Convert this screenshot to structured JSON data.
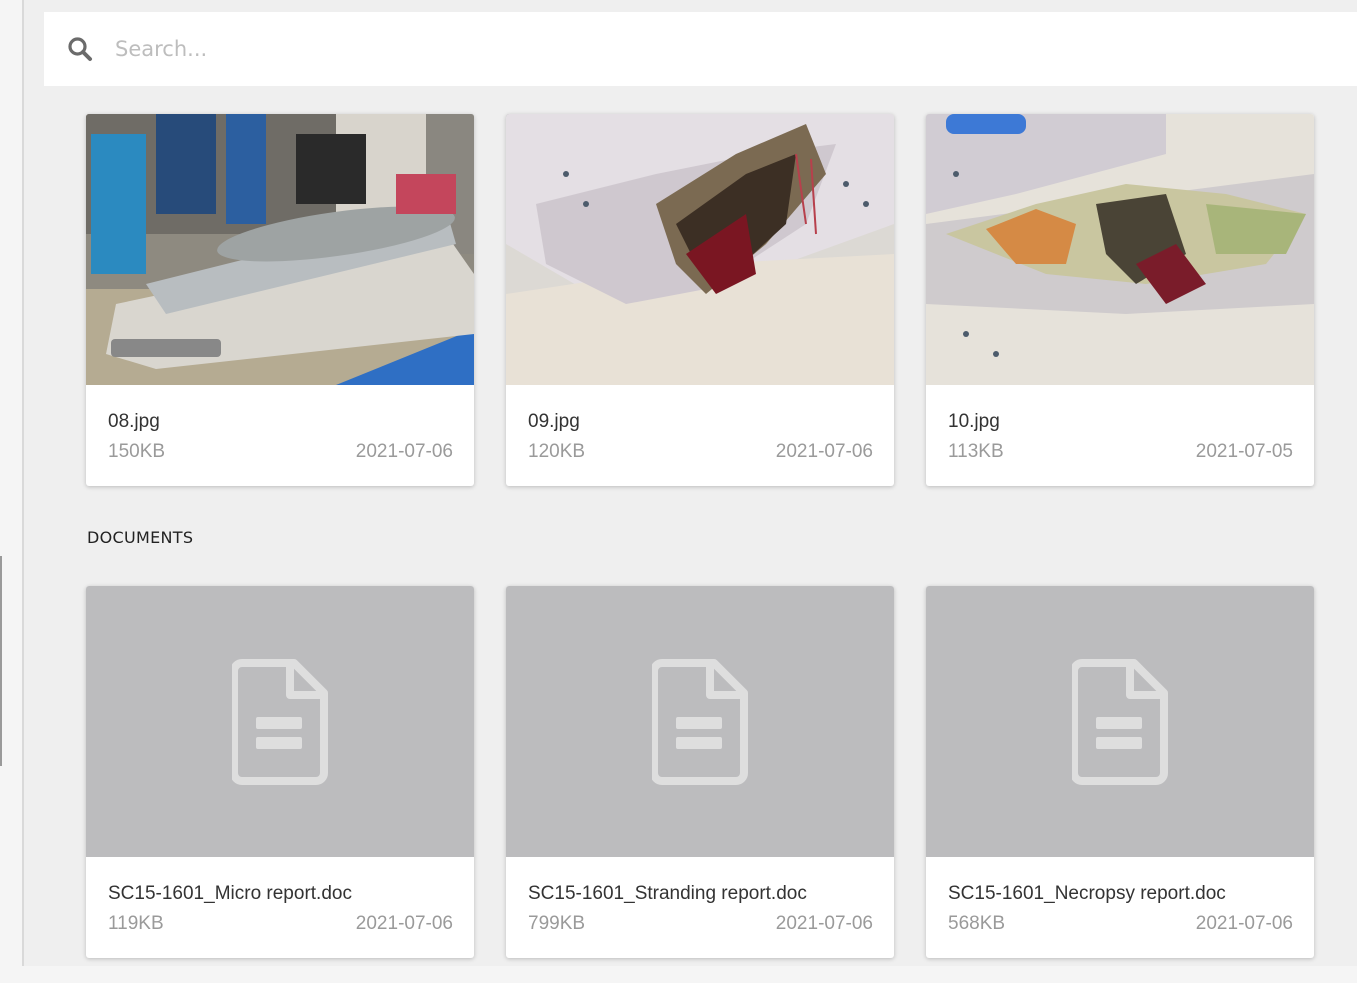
{
  "search": {
    "placeholder": "Search..."
  },
  "images": [
    {
      "name": "08.jpg",
      "size": "150KB",
      "date": "2021-07-06"
    },
    {
      "name": "09.jpg",
      "size": "120KB",
      "date": "2021-07-06"
    },
    {
      "name": "10.jpg",
      "size": "113KB",
      "date": "2021-07-05"
    }
  ],
  "documents_section": {
    "title": "DOCUMENTS"
  },
  "documents": [
    {
      "name": "SC15-1601_Micro report.doc",
      "size": "119KB",
      "date": "2021-07-06",
      "icon": "document-icon"
    },
    {
      "name": "SC15-1601_Stranding report.doc",
      "size": "799KB",
      "date": "2021-07-06",
      "icon": "document-icon"
    },
    {
      "name": "SC15-1601_Necropsy report.doc",
      "size": "568KB",
      "date": "2021-07-06",
      "icon": "document-icon"
    }
  ],
  "colors": {
    "background": "#efefef",
    "doc_thumb": "#bcbcbe",
    "meta_text": "#9a9a9a"
  }
}
